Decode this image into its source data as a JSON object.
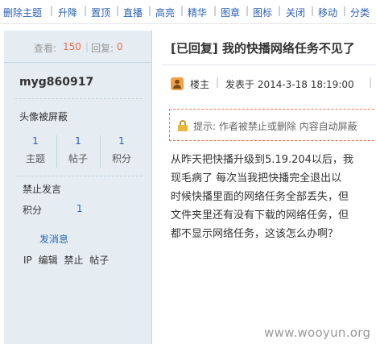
{
  "toolbar": {
    "items": [
      "删除主题",
      "升降",
      "置顶",
      "直播",
      "高亮",
      "精华",
      "图章",
      "图标",
      "关闭",
      "移动",
      "分类"
    ],
    "separator": "|"
  },
  "sidebar": {
    "views_label": "查看:",
    "views_value": "150",
    "replies_label": "回复:",
    "replies_value": "0",
    "username": "myg860917",
    "avatar_text": "头像被屏蔽",
    "stats": [
      {
        "value": "1",
        "label": "主题"
      },
      {
        "value": "1",
        "label": "帖子"
      },
      {
        "value": "1",
        "label": "积分"
      }
    ],
    "ban_text": "禁止发言",
    "credit_label": "积分",
    "credit_value": "1",
    "send_message": "发消息",
    "admin_links": [
      "IP",
      "编辑",
      "禁止",
      "帖子"
    ]
  },
  "post": {
    "title": "[已回复] 我的快播网络任务不见了",
    "author_label": "楼主",
    "separator": "|",
    "posted_at": "发表于 2014-3-18 18:19:00",
    "notice": "提示: 作者被禁止或删除 内容自动屏蔽",
    "body_lines": [
      "从昨天把快播升级到5.19.204以后，我",
      "现毛病了  每次当我把快播完全退出以",
      "时候快播里面的网络任务全部丢失，但",
      "文件夹里还有没有下载的网络任务，但",
      "都不显示网络任务，这该怎么办啊？"
    ]
  },
  "watermark": "www.wooyun.org",
  "colors": {
    "link": "#2b62b3",
    "sidebar_bg": "#e5edf2",
    "sidebar_border": "#c2d5e3",
    "accent_red": "#f26c4f"
  },
  "icons": {
    "author": "user-icon",
    "notice": "lock-icon"
  }
}
